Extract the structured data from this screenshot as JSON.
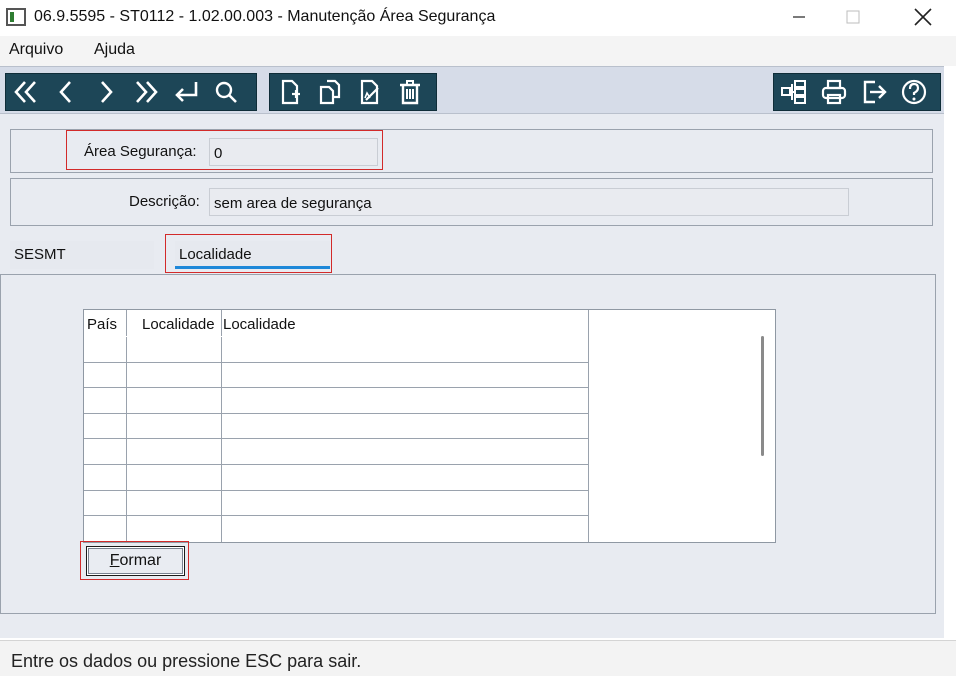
{
  "window": {
    "title": "06.9.5595 - ST0112 - 1.02.00.003 - Manutenção Área Segurança",
    "minimize_icon": "minimize-icon",
    "maximize_icon": "maximize-icon",
    "close_icon": "close-icon"
  },
  "menu": {
    "items": [
      {
        "label": "Arquivo"
      },
      {
        "label": "Ajuda"
      }
    ]
  },
  "toolbar": {
    "nav_icons": [
      "first-record-icon",
      "previous-record-icon",
      "next-record-icon",
      "last-record-icon",
      "return-icon",
      "search-icon"
    ],
    "edit_icons": [
      "new-record-icon",
      "copy-record-icon",
      "edit-record-icon",
      "delete-record-icon"
    ],
    "right_icons": [
      "tree-view-icon",
      "print-icon",
      "exit-icon",
      "help-icon"
    ],
    "background": "#1d4657"
  },
  "form": {
    "area_label": "Área Segurança:",
    "area_value": "0",
    "descricao_label": "Descrição:",
    "descricao_value": "sem area de segurança"
  },
  "tabs": [
    {
      "label": "SESMT",
      "active": false
    },
    {
      "label": "Localidade",
      "active": true
    }
  ],
  "grid": {
    "columns": [
      "País",
      "Localidade",
      "Localidade"
    ],
    "rows": [
      [
        "",
        "",
        ""
      ],
      [
        "",
        "",
        ""
      ],
      [
        "",
        "",
        ""
      ],
      [
        "",
        "",
        ""
      ],
      [
        "",
        "",
        ""
      ],
      [
        "",
        "",
        ""
      ],
      [
        "",
        "",
        ""
      ]
    ]
  },
  "formar_button": {
    "label_underlined": "F",
    "label_rest": "ormar"
  },
  "status": {
    "text": "Entre os dados ou pressione ESC para sair."
  },
  "colors": {
    "highlight": "#d22a2a",
    "active_tab_underline": "#1e88d9"
  }
}
